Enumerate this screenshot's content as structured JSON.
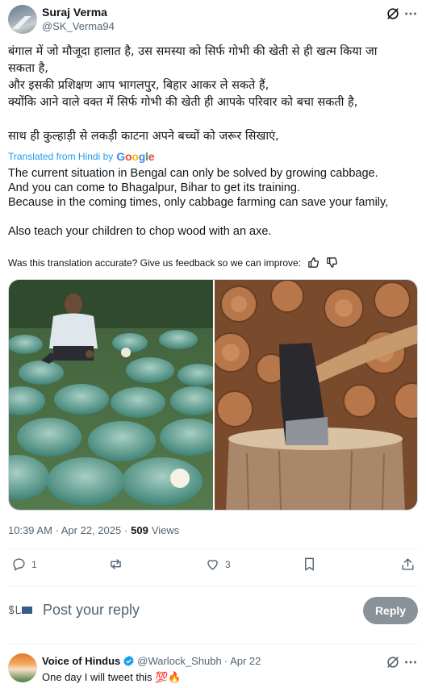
{
  "post": {
    "author_name": "Suraj Verma",
    "author_handle": "@SK_Verma94",
    "original_lines": [
      "बंगाल में जो मौजूदा हालात है, उस समस्या को सिर्फ गोभी की खेती से ही खत्म किया जा",
      "सकता है,",
      "और इसकी प्रशिक्षण आप भागलपुर, बिहार आकर ले सकते हैं,",
      "क्योंकि आने वाले वक्त में सिर्फ गोभी की खेती ही आपके परिवार को बचा सकती है,",
      "साथ ही कुल्हाड़ी से लकड़ी काटना अपने बच्चों को जरूर सिखाएं,"
    ],
    "translated_from": "Translated from Hindi by",
    "translator": "Google",
    "translation_lines": [
      "The current situation in Bengal can only be solved by growing cabbage.",
      "And you can come to Bhagalpur, Bihar to get its training.",
      "Because in the coming times, only cabbage farming can save your family,",
      "Also teach your children to chop wood with an axe."
    ],
    "feedback_text": "Was this translation accurate? Give us feedback so we can improve:",
    "time": "10:39 AM · Apr 22, 2025 ·",
    "views_count": "509",
    "views_label": "Views"
  },
  "actions": {
    "replies": "1",
    "reposts": "",
    "likes": "3"
  },
  "reply_box": {
    "placeholder": "Post your reply",
    "button_label": "Reply"
  },
  "reply": {
    "name": "Voice of Hindus",
    "handle": "@Warlock_Shubh",
    "dot": "·",
    "date": "Apr 22",
    "text": "One day I will tweet this 💯🔥"
  },
  "colors": {
    "accent": "#1d9bf0",
    "muted": "#536471",
    "text": "#0f1419",
    "reply_button": "#8a9299"
  }
}
